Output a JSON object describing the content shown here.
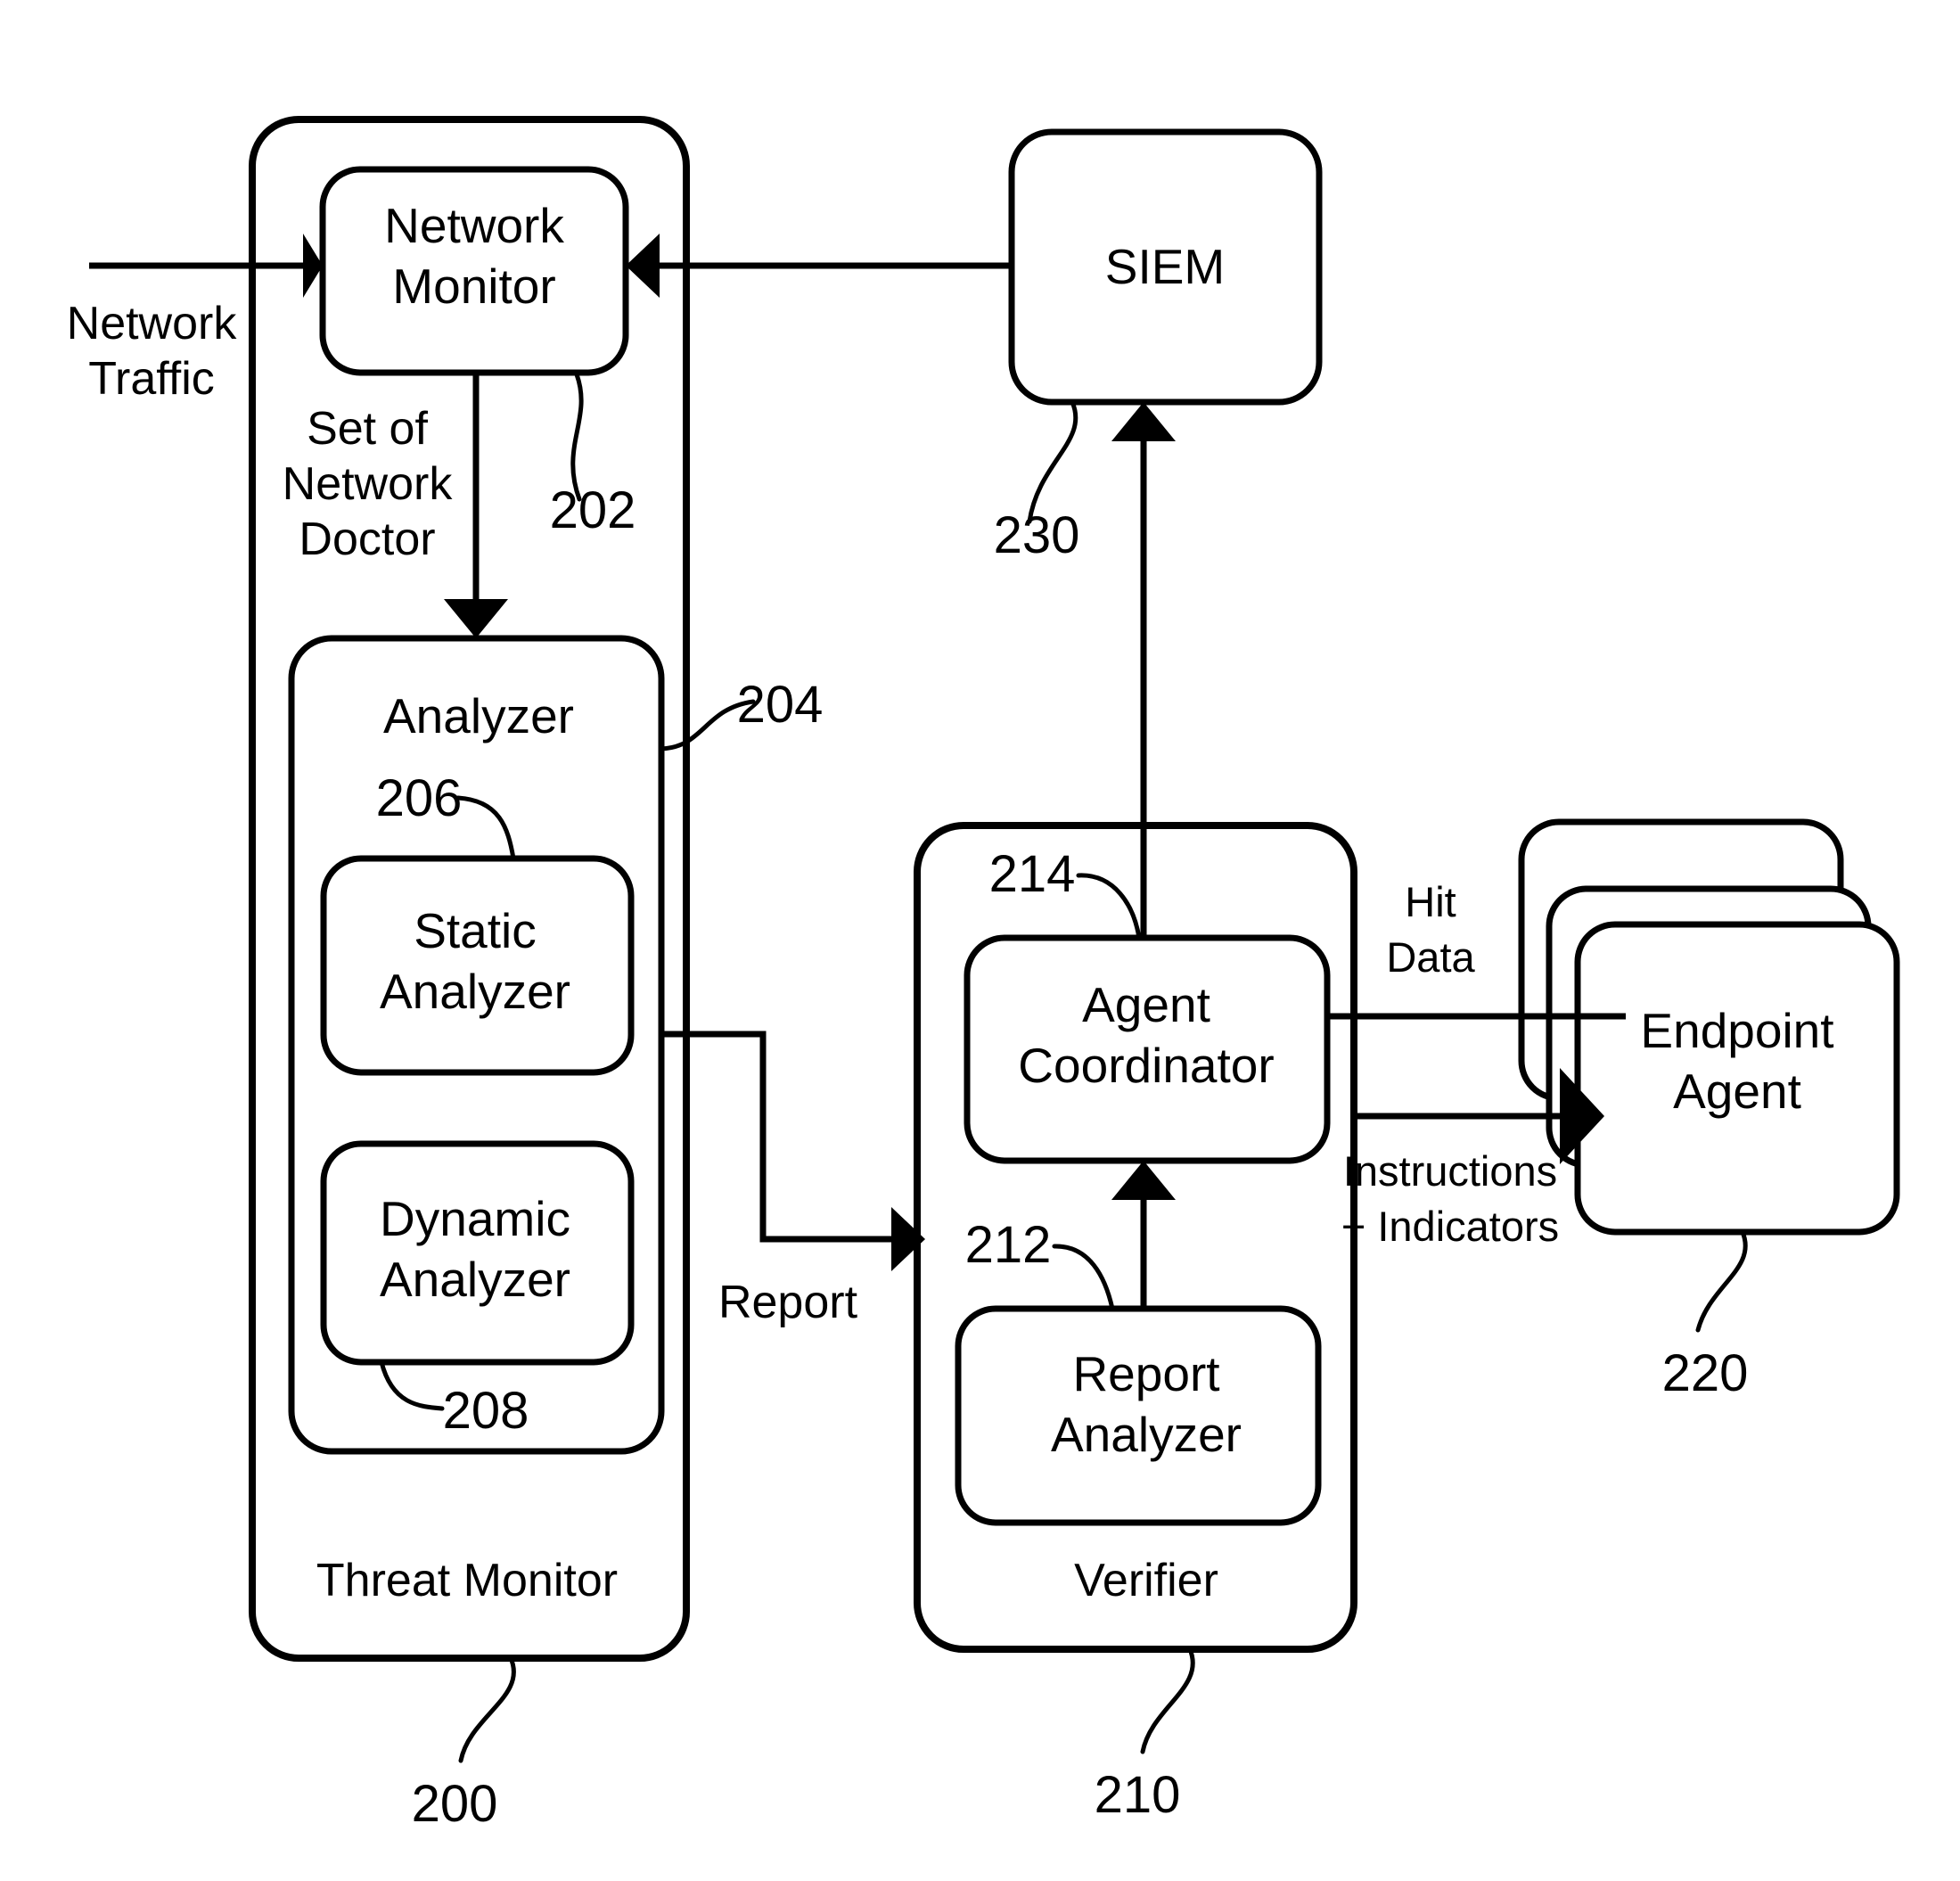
{
  "figure": {
    "type": "patent-block-diagram",
    "background_color": "#ffffff",
    "line_color": "#000000"
  },
  "containers": {
    "threat_monitor": {
      "label": "Threat Monitor",
      "ref": "200"
    },
    "verifier": {
      "label": "Verifier",
      "ref": "210"
    },
    "analyzer": {
      "label": "Analyzer",
      "ref": "204"
    }
  },
  "blocks": {
    "network_monitor": {
      "line1": "Network",
      "line2": "Monitor",
      "ref": "202"
    },
    "static_analyzer": {
      "line1": "Static",
      "line2": "Analyzer",
      "ref": "206"
    },
    "dynamic_analyzer": {
      "line1": "Dynamic",
      "line2": "Analyzer",
      "ref": "208"
    },
    "siem": {
      "label": "SIEM",
      "ref": "230"
    },
    "agent_coordinator": {
      "line1": "Agent",
      "line2": "Coordinator",
      "ref": "214"
    },
    "report_analyzer": {
      "line1": "Report",
      "line2": "Analyzer",
      "ref": "212"
    },
    "endpoint_agent": {
      "line1": "Endpoint",
      "line2": "Agent",
      "ref": "220"
    }
  },
  "edge_labels": {
    "network_traffic": {
      "line1": "Network",
      "line2": "Traffic"
    },
    "set_of_network_doctor": {
      "line1": "Set of",
      "line2": "Network",
      "line3": "Doctor"
    },
    "report": {
      "label": "Report"
    },
    "hit_data": {
      "line1": "Hit",
      "line2": "Data"
    },
    "instructions_indicators": {
      "line1": "Instructions",
      "line2": "+ Indicators"
    }
  }
}
